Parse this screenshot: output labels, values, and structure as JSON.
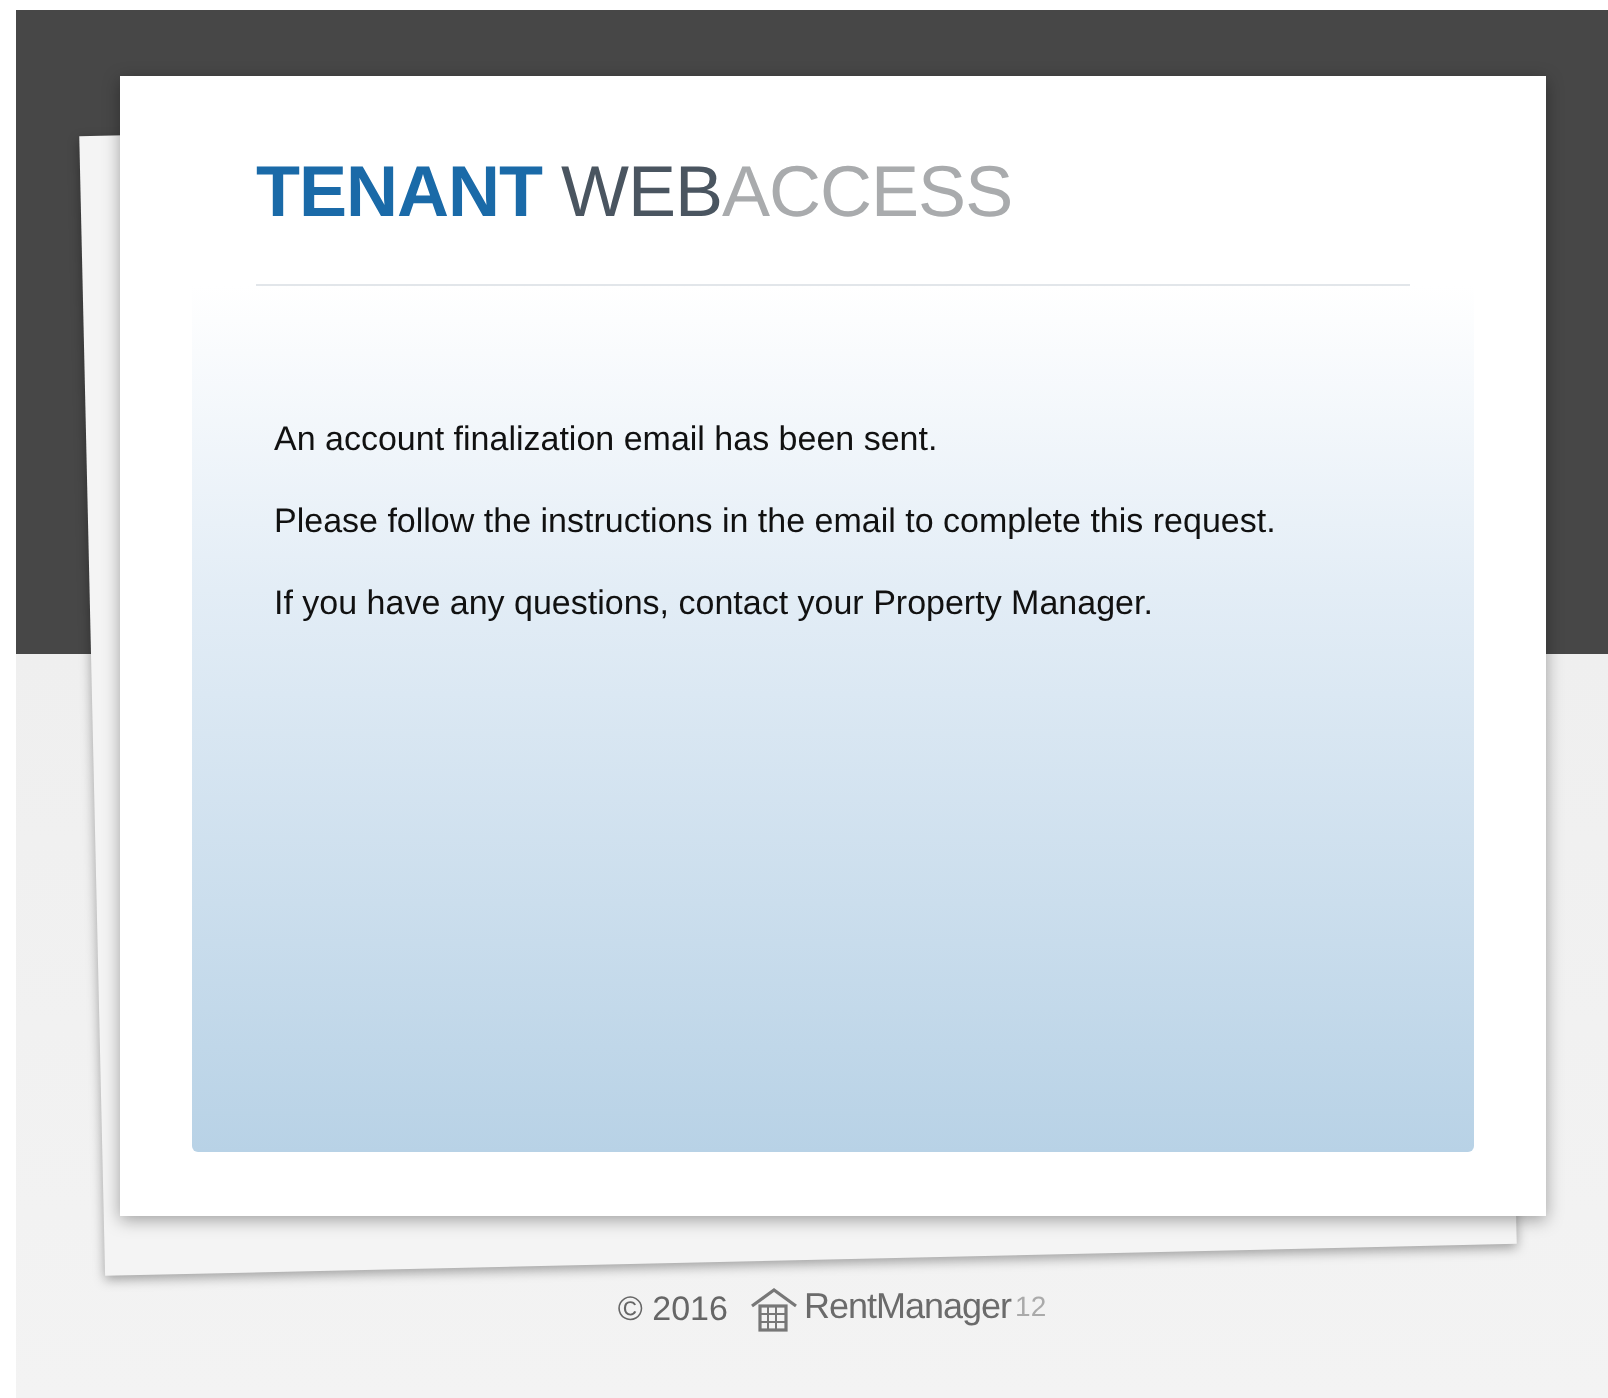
{
  "logo": {
    "parts": [
      {
        "text": "TENANT",
        "kind": "primary"
      },
      {
        "text": "WEB",
        "kind": "secondary",
        "space_before": true
      },
      {
        "text": "ACCESS",
        "kind": "muted"
      }
    ]
  },
  "messages": [
    "An account finalization email has been sent.",
    "Please follow the instructions in the email to complete this request.",
    "If you have any questions, contact your Property Manager."
  ],
  "footer": {
    "copyright": "© 2016",
    "brand": "RentManager",
    "version": "12"
  }
}
